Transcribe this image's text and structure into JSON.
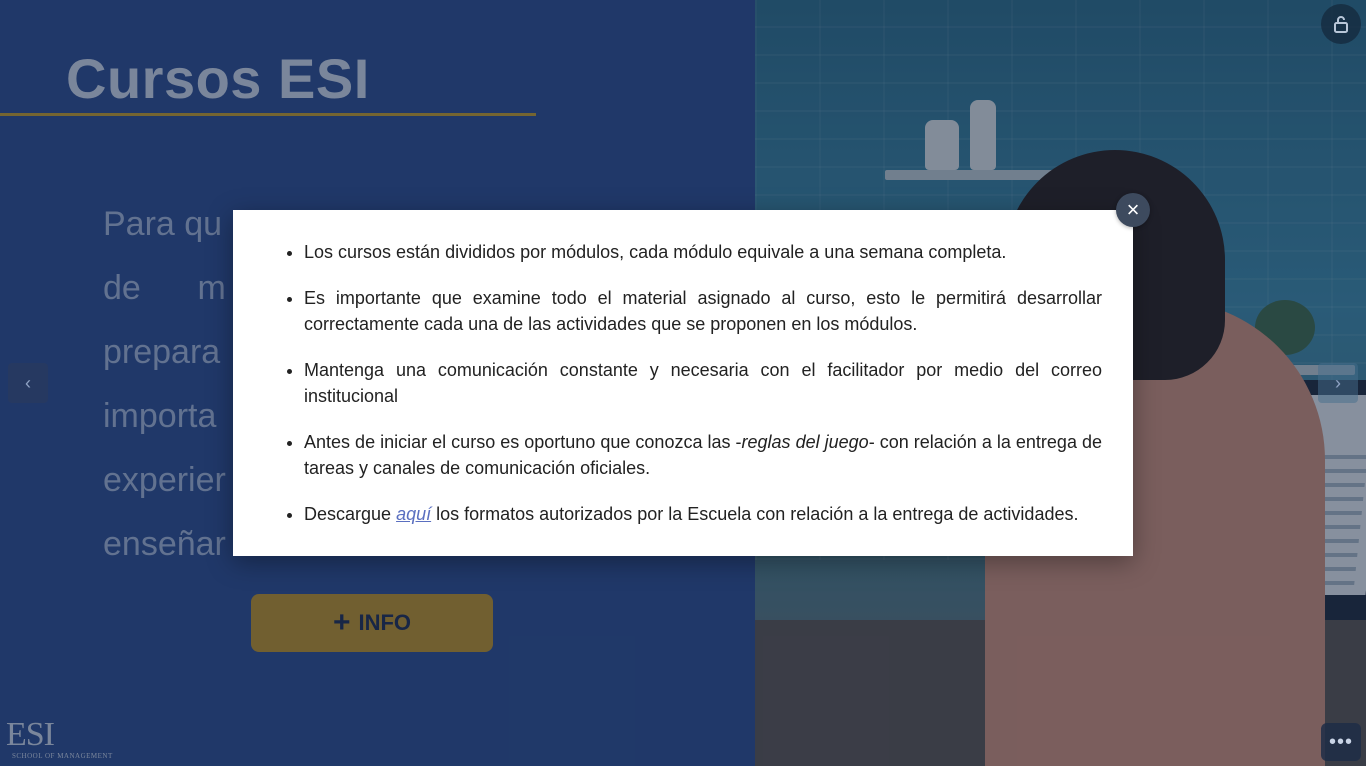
{
  "slide": {
    "title": "Cursos ESI",
    "paragraph_lines": [
      "Para qu",
      "de      m",
      "prepara",
      "importa",
      "experier",
      "enseñar"
    ],
    "info_button": {
      "icon": "+",
      "label": "INFO"
    },
    "logo": {
      "main": "ESI",
      "sub": "SCHOOL OF MANAGEMENT"
    }
  },
  "modal": {
    "items": [
      {
        "text": "Los cursos están divididos por módulos, cada módulo equivale a una semana completa."
      },
      {
        "text": "Es importante que examine todo el material asignado al curso, esto le permitirá desarrollar correctamente cada una de las actividades que se proponen en los módulos."
      },
      {
        "text": "Mantenga una comunicación constante y necesaria con el facilitador por medio del correo institucional"
      },
      {
        "before": "Antes de iniciar el curso es oportuno que conozca las -",
        "emphasis": "reglas del juego",
        "after": "- con relación a la entrega de tareas y canales de comunicación oficiales."
      },
      {
        "before": "Descargue ",
        "link": "aquí",
        "after": " los formatos autorizados por la Escuela con relación a la entrega de actividades."
      }
    ],
    "close_icon": "×"
  },
  "controls": {
    "prev_icon": "‹",
    "next_icon": "›",
    "menu_icon": "•••"
  },
  "colors": {
    "slide_blue": "#2d4f8f",
    "accent_gold": "#bf9b2f",
    "link": "#5a6fc0"
  }
}
